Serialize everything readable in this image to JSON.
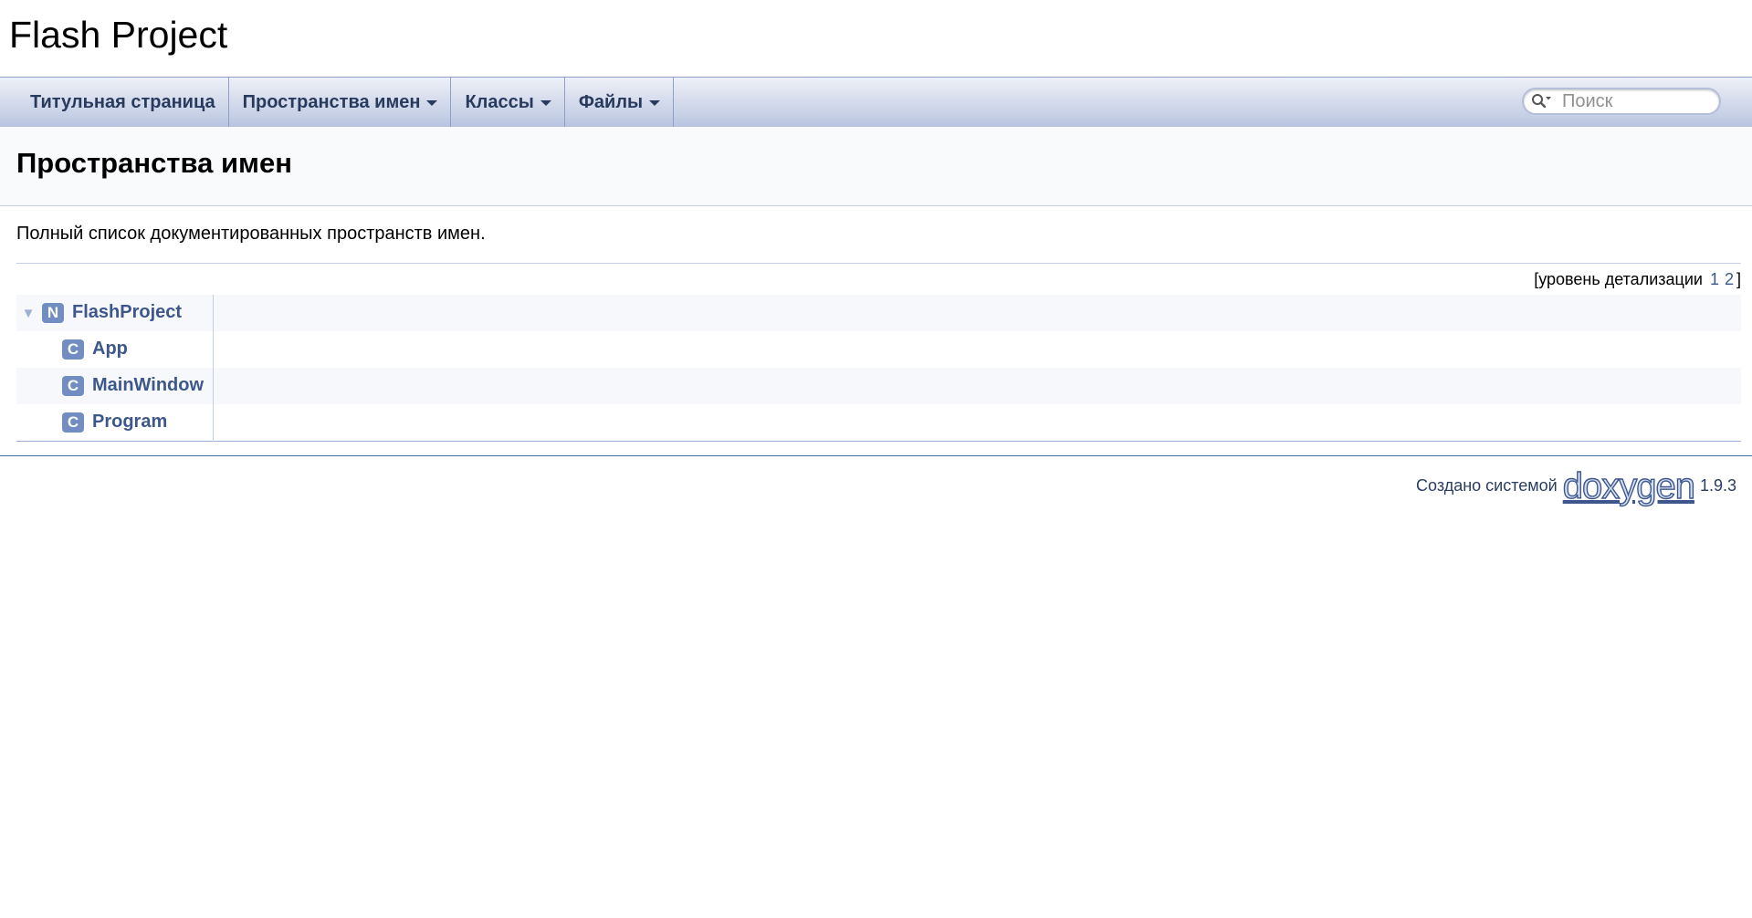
{
  "project": {
    "name": "Flash Project"
  },
  "nav": {
    "items": [
      {
        "label": "Титульная страница",
        "has_dropdown": false
      },
      {
        "label": "Пространства имен",
        "has_dropdown": true
      },
      {
        "label": "Классы",
        "has_dropdown": true
      },
      {
        "label": "Файлы",
        "has_dropdown": true
      }
    ],
    "search": {
      "placeholder": "Поиск",
      "icon": "search-icon"
    }
  },
  "header": {
    "title": "Пространства имен"
  },
  "contents": {
    "description": "Полный список документированных пространств имен.",
    "levels": {
      "label": "уровень детализации",
      "open_bracket": "[",
      "close_bracket": "]",
      "values": [
        "1",
        "2"
      ]
    },
    "tree": {
      "namespace": {
        "icon_letter": "N",
        "name": "FlashProject",
        "expanded_glyph": "▼"
      },
      "classes": [
        {
          "icon_letter": "C",
          "name": "App"
        },
        {
          "icon_letter": "C",
          "name": "MainWindow"
        },
        {
          "icon_letter": "C",
          "name": "Program"
        }
      ]
    }
  },
  "footer": {
    "generated_by": "Создано системой",
    "logo_text": "doxygen",
    "version": "1.9.3"
  },
  "colors": {
    "link": "#3d578c",
    "icon_bg": "#728dc1",
    "nav_text": "#283a5d"
  }
}
